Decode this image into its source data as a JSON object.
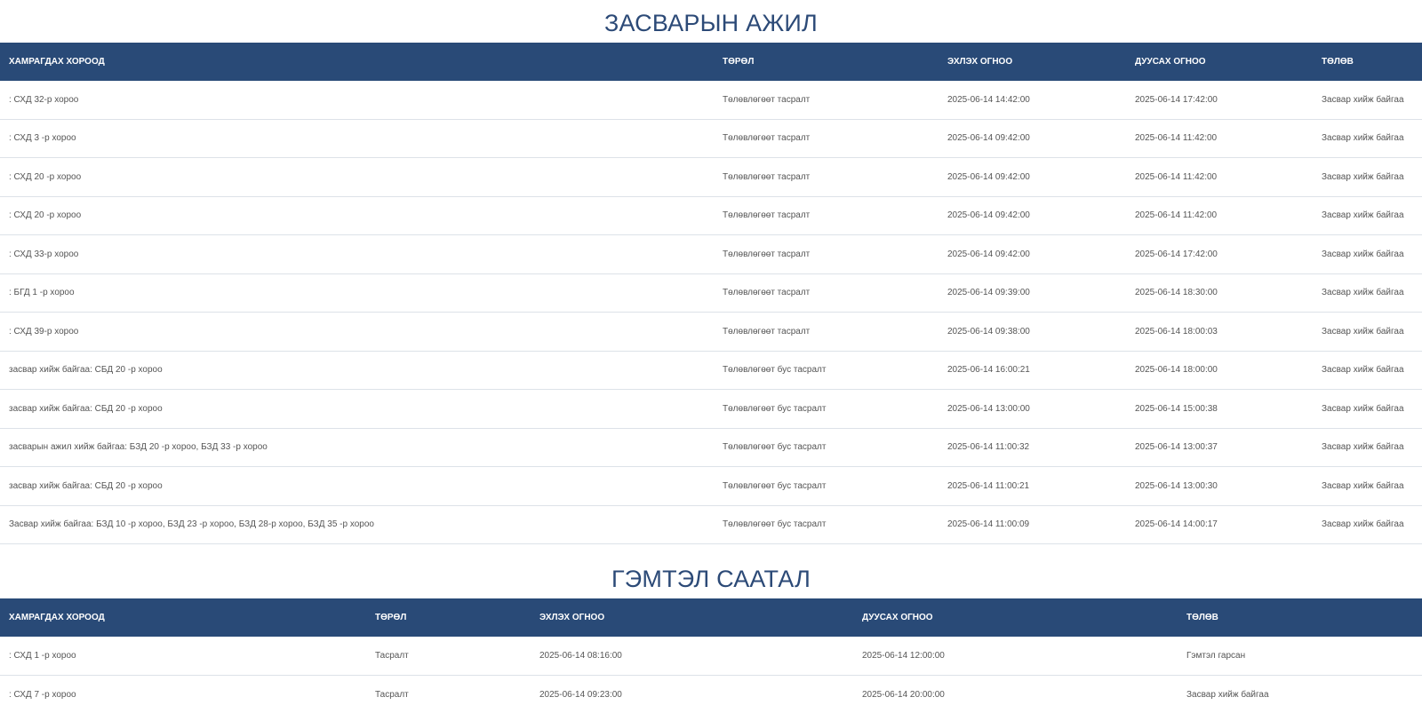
{
  "repair": {
    "title": "ЗАСВАРЫН АЖИЛ",
    "headers": [
      "ХАМРАГДАХ ХОРООД",
      "ТӨРӨЛ",
      "ЭХЛЭХ ОГНОО",
      "ДУУСАХ ОГНОО",
      "ТӨЛӨВ"
    ],
    "rows": [
      [
        ": СХД 32-р хороо",
        "Төлөвлөгөөт тасралт",
        "2025-06-14 14:42:00",
        "2025-06-14 17:42:00",
        "Засвар хийж байгаа"
      ],
      [
        ": СХД 3 -р хороо",
        "Төлөвлөгөөт тасралт",
        "2025-06-14 09:42:00",
        "2025-06-14 11:42:00",
        "Засвар хийж байгаа"
      ],
      [
        ": СХД 20 -р хороо",
        "Төлөвлөгөөт тасралт",
        "2025-06-14 09:42:00",
        "2025-06-14 11:42:00",
        "Засвар хийж байгаа"
      ],
      [
        ": СХД 20 -р хороо",
        "Төлөвлөгөөт тасралт",
        "2025-06-14 09:42:00",
        "2025-06-14 11:42:00",
        "Засвар хийж байгаа"
      ],
      [
        ": СХД 33-р хороо",
        "Төлөвлөгөөт тасралт",
        "2025-06-14 09:42:00",
        "2025-06-14 17:42:00",
        "Засвар хийж байгаа"
      ],
      [
        ": БГД 1 -р хороо",
        "Төлөвлөгөөт тасралт",
        "2025-06-14 09:39:00",
        "2025-06-14 18:30:00",
        "Засвар хийж байгаа"
      ],
      [
        ": СХД 39-р хороо",
        "Төлөвлөгөөт тасралт",
        "2025-06-14 09:38:00",
        "2025-06-14 18:00:03",
        "Засвар хийж байгаа"
      ],
      [
        "засвар хийж байгаа: СБД 20 -р хороо",
        "Төлөвлөгөөт бус тасралт",
        "2025-06-14 16:00:21",
        "2025-06-14 18:00:00",
        "Засвар хийж байгаа"
      ],
      [
        "засвар хийж байгаа: СБД 20 -р хороо",
        "Төлөвлөгөөт бус тасралт",
        "2025-06-14 13:00:00",
        "2025-06-14 15:00:38",
        "Засвар хийж байгаа"
      ],
      [
        "засварын ажил хийж байгаа: БЗД 20 -р хороо, БЗД 33 -р хороо",
        "Төлөвлөгөөт бус тасралт",
        "2025-06-14 11:00:32",
        "2025-06-14 13:00:37",
        "Засвар хийж байгаа"
      ],
      [
        "засвар хийж байгаа: СБД 20 -р хороо",
        "Төлөвлөгөөт бус тасралт",
        "2025-06-14 11:00:21",
        "2025-06-14 13:00:30",
        "Засвар хийж байгаа"
      ],
      [
        "Засвар хийж байгаа: БЗД 10 -р хороо, БЗД 23 -р хороо, БЗД 28-р хороо, БЗД 35 -р хороо",
        "Төлөвлөгөөт бус тасралт",
        "2025-06-14 11:00:09",
        "2025-06-14 14:00:17",
        "Засвар хийж байгаа"
      ]
    ]
  },
  "failure": {
    "title": "ГЭМТЭЛ СААТАЛ",
    "headers": [
      "ХАМРАГДАХ ХОРООД",
      "ТӨРӨЛ",
      "ЭХЛЭХ ОГНОО",
      "ДУУСАХ ОГНОО",
      "ТӨЛӨВ"
    ],
    "rows": [
      [
        ": СХД 1 -р хороо",
        "Тасралт",
        "2025-06-14 08:16:00",
        "2025-06-14 12:00:00",
        "Гэмтэл гарсан"
      ],
      [
        ": СХД 7 -р хороо",
        "Тасралт",
        "2025-06-14 09:23:00",
        "2025-06-14 20:00:00",
        "Засвар хийж байгаа"
      ]
    ]
  },
  "colors": {
    "header_bg": "#294a77",
    "title": "#2c4a77",
    "row_text": "#555555",
    "row_divider": "#dde2e8"
  }
}
